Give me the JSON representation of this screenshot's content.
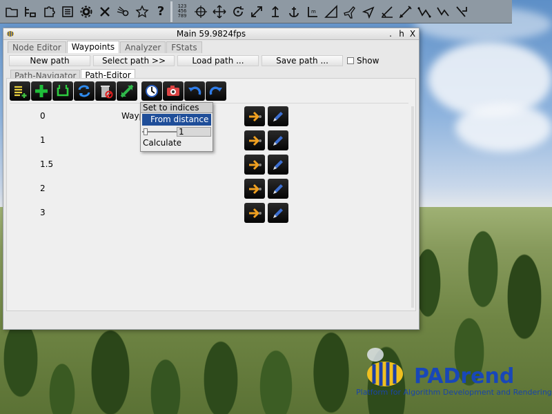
{
  "window": {
    "title": "Main 59.9824fps",
    "controls": {
      "dot": ".",
      "hide": "h",
      "close": "X"
    }
  },
  "main_tabs": [
    "Node Editor",
    "Waypoints",
    "Analyzer",
    "FStats"
  ],
  "actions": {
    "new_path": "New path",
    "select_path": "Select path >>",
    "load_path": "Load path ...",
    "save_path": "Save path ...",
    "show_label": "Show"
  },
  "sub_tabs": [
    "Path-Navigator",
    "Path-Editor"
  ],
  "waypoints": [
    {
      "index": "0",
      "name": "Waypoint"
    },
    {
      "index": "1",
      "name": ""
    },
    {
      "index": "1.5",
      "name": ""
    },
    {
      "index": "2",
      "name": ""
    },
    {
      "index": "3",
      "name": ""
    }
  ],
  "popup": {
    "header": "Set to indices",
    "item": "From distance",
    "value": "1",
    "calculate": "Calculate"
  },
  "logo": {
    "text": "PADrend",
    "tagline": "Platform for Algorithm Development and Rendering"
  },
  "colors": {
    "toolbar_bg": "#8e99a3",
    "window_bg": "#e8e8e8",
    "selection": "#1f4e99",
    "arrow_icon": "#f0a020",
    "edit_icon": "#3c6fd1",
    "logo_blue": "#1847b8"
  },
  "icons": {
    "top_toolbar": [
      "folder-icon",
      "tree-icon",
      "puzzle-icon",
      "list-icon",
      "gear-icon",
      "tools-icon",
      "comet-icon",
      "star-icon",
      "help-icon",
      "numbers-icon",
      "target-icon",
      "move-icon",
      "rotate-icon",
      "scale-icon",
      "anchor-up-icon",
      "anchor-icon",
      "measure-icon",
      "triangle-select-icon",
      "plane-icon",
      "cursor-icon",
      "brush-icon",
      "pen-icon",
      "path-icon",
      "curve-icon",
      "node-walk-icon"
    ],
    "editor_toolbar": [
      "add-list-icon",
      "add-icon",
      "loop-icon",
      "refresh-icon",
      "delete-icon",
      "expand-icon",
      "clock-icon",
      "camera-icon",
      "undo-icon",
      "redo-icon"
    ]
  }
}
